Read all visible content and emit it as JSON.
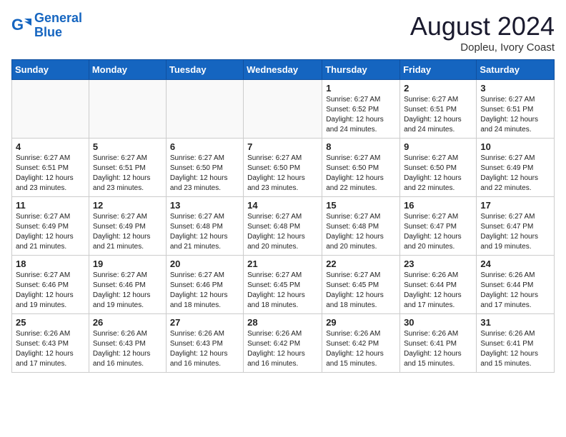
{
  "logo": {
    "line1": "General",
    "line2": "Blue"
  },
  "title": "August 2024",
  "location": "Dopleu, Ivory Coast",
  "days_header": [
    "Sunday",
    "Monday",
    "Tuesday",
    "Wednesday",
    "Thursday",
    "Friday",
    "Saturday"
  ],
  "weeks": [
    [
      {
        "day": "",
        "info": ""
      },
      {
        "day": "",
        "info": ""
      },
      {
        "day": "",
        "info": ""
      },
      {
        "day": "",
        "info": ""
      },
      {
        "day": "1",
        "info": "Sunrise: 6:27 AM\nSunset: 6:52 PM\nDaylight: 12 hours\nand 24 minutes."
      },
      {
        "day": "2",
        "info": "Sunrise: 6:27 AM\nSunset: 6:51 PM\nDaylight: 12 hours\nand 24 minutes."
      },
      {
        "day": "3",
        "info": "Sunrise: 6:27 AM\nSunset: 6:51 PM\nDaylight: 12 hours\nand 24 minutes."
      }
    ],
    [
      {
        "day": "4",
        "info": "Sunrise: 6:27 AM\nSunset: 6:51 PM\nDaylight: 12 hours\nand 23 minutes."
      },
      {
        "day": "5",
        "info": "Sunrise: 6:27 AM\nSunset: 6:51 PM\nDaylight: 12 hours\nand 23 minutes."
      },
      {
        "day": "6",
        "info": "Sunrise: 6:27 AM\nSunset: 6:50 PM\nDaylight: 12 hours\nand 23 minutes."
      },
      {
        "day": "7",
        "info": "Sunrise: 6:27 AM\nSunset: 6:50 PM\nDaylight: 12 hours\nand 23 minutes."
      },
      {
        "day": "8",
        "info": "Sunrise: 6:27 AM\nSunset: 6:50 PM\nDaylight: 12 hours\nand 22 minutes."
      },
      {
        "day": "9",
        "info": "Sunrise: 6:27 AM\nSunset: 6:50 PM\nDaylight: 12 hours\nand 22 minutes."
      },
      {
        "day": "10",
        "info": "Sunrise: 6:27 AM\nSunset: 6:49 PM\nDaylight: 12 hours\nand 22 minutes."
      }
    ],
    [
      {
        "day": "11",
        "info": "Sunrise: 6:27 AM\nSunset: 6:49 PM\nDaylight: 12 hours\nand 21 minutes."
      },
      {
        "day": "12",
        "info": "Sunrise: 6:27 AM\nSunset: 6:49 PM\nDaylight: 12 hours\nand 21 minutes."
      },
      {
        "day": "13",
        "info": "Sunrise: 6:27 AM\nSunset: 6:48 PM\nDaylight: 12 hours\nand 21 minutes."
      },
      {
        "day": "14",
        "info": "Sunrise: 6:27 AM\nSunset: 6:48 PM\nDaylight: 12 hours\nand 20 minutes."
      },
      {
        "day": "15",
        "info": "Sunrise: 6:27 AM\nSunset: 6:48 PM\nDaylight: 12 hours\nand 20 minutes."
      },
      {
        "day": "16",
        "info": "Sunrise: 6:27 AM\nSunset: 6:47 PM\nDaylight: 12 hours\nand 20 minutes."
      },
      {
        "day": "17",
        "info": "Sunrise: 6:27 AM\nSunset: 6:47 PM\nDaylight: 12 hours\nand 19 minutes."
      }
    ],
    [
      {
        "day": "18",
        "info": "Sunrise: 6:27 AM\nSunset: 6:46 PM\nDaylight: 12 hours\nand 19 minutes."
      },
      {
        "day": "19",
        "info": "Sunrise: 6:27 AM\nSunset: 6:46 PM\nDaylight: 12 hours\nand 19 minutes."
      },
      {
        "day": "20",
        "info": "Sunrise: 6:27 AM\nSunset: 6:46 PM\nDaylight: 12 hours\nand 18 minutes."
      },
      {
        "day": "21",
        "info": "Sunrise: 6:27 AM\nSunset: 6:45 PM\nDaylight: 12 hours\nand 18 minutes."
      },
      {
        "day": "22",
        "info": "Sunrise: 6:27 AM\nSunset: 6:45 PM\nDaylight: 12 hours\nand 18 minutes."
      },
      {
        "day": "23",
        "info": "Sunrise: 6:26 AM\nSunset: 6:44 PM\nDaylight: 12 hours\nand 17 minutes."
      },
      {
        "day": "24",
        "info": "Sunrise: 6:26 AM\nSunset: 6:44 PM\nDaylight: 12 hours\nand 17 minutes."
      }
    ],
    [
      {
        "day": "25",
        "info": "Sunrise: 6:26 AM\nSunset: 6:43 PM\nDaylight: 12 hours\nand 17 minutes."
      },
      {
        "day": "26",
        "info": "Sunrise: 6:26 AM\nSunset: 6:43 PM\nDaylight: 12 hours\nand 16 minutes."
      },
      {
        "day": "27",
        "info": "Sunrise: 6:26 AM\nSunset: 6:43 PM\nDaylight: 12 hours\nand 16 minutes."
      },
      {
        "day": "28",
        "info": "Sunrise: 6:26 AM\nSunset: 6:42 PM\nDaylight: 12 hours\nand 16 minutes."
      },
      {
        "day": "29",
        "info": "Sunrise: 6:26 AM\nSunset: 6:42 PM\nDaylight: 12 hours\nand 15 minutes."
      },
      {
        "day": "30",
        "info": "Sunrise: 6:26 AM\nSunset: 6:41 PM\nDaylight: 12 hours\nand 15 minutes."
      },
      {
        "day": "31",
        "info": "Sunrise: 6:26 AM\nSunset: 6:41 PM\nDaylight: 12 hours\nand 15 minutes."
      }
    ]
  ]
}
